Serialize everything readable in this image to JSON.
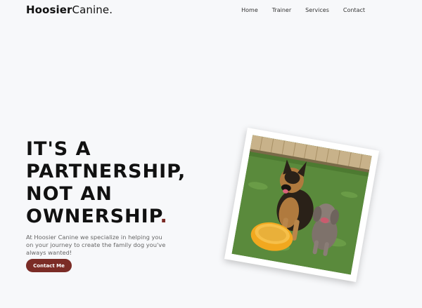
{
  "brand": {
    "bold": "Hoosier",
    "regular": "Canine."
  },
  "nav": {
    "items": [
      "Home",
      "Trainer",
      "Services",
      "Contact"
    ]
  },
  "hero": {
    "headline_lines": [
      "IT'S A",
      "PARTNERSHIP,",
      "NOT AN",
      "OWNERSHIP"
    ],
    "headline_end": ".",
    "subtext": "At Hoosier Canine we specialize in helping you on your journey to create the family dog you've always wanted!",
    "cta_label": "Contact Me"
  },
  "colors": {
    "accent": "#7b2c26",
    "background": "#f7f8fa"
  }
}
